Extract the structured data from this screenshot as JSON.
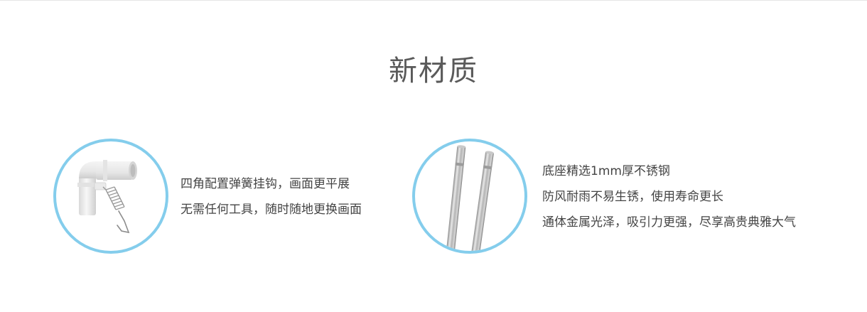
{
  "section": {
    "title": "新材质"
  },
  "features": [
    {
      "image": "white-pvc-elbow-with-spring-hook",
      "lines": [
        "四角配置弹簧挂钩，画面更平展",
        "无需任何工具，随时随地更换画面"
      ]
    },
    {
      "image": "two-stainless-steel-rods",
      "lines": [
        "底座精选1mm厚不锈钢",
        "防风耐雨不易生锈，使用寿命更长",
        "通体金属光泽，吸引力更强，尽享高贵典雅大气"
      ]
    }
  ],
  "colors": {
    "circle_border": "#84cdec",
    "title": "#5a5a5a",
    "body_text": "#444444"
  }
}
